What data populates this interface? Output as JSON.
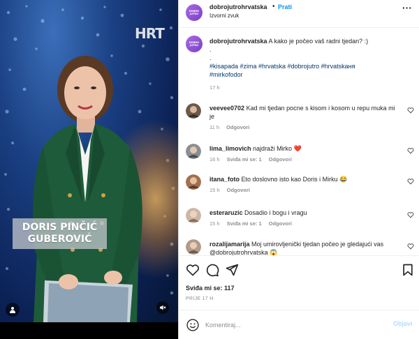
{
  "video": {
    "channel_logo": "HRT",
    "name_line1": "DORIS PINČIĆ",
    "name_line2": "GUBEROVIĆ",
    "tagged_users_icon": "person-icon",
    "mute_icon": "muted-speaker-icon"
  },
  "post": {
    "username": "dobrojutrohrvatska",
    "follow_label": "Prati",
    "audio_label": "Izvorni zvuk",
    "avatar_text_1": "DOBRO",
    "avatar_text_2": "JUTRO",
    "caption_user": "dobrojutrohrvatska",
    "caption_text": "A kako je počeo vaš radni tjedan? :)",
    "caption_dot1": ".",
    "caption_dot2": ".",
    "hashtags_line1": "#kisapada #zima #hrvatska #dobrojutro #hrvatskaня",
    "hashtags_line2": "#mirkofodor",
    "caption_time": "17 h"
  },
  "comments": [
    {
      "user": "veevee0702",
      "text": "Kad mi tjedan pocne s kisom i kosom u repu muka mi je",
      "time": "11 h",
      "likes": "",
      "reply": "Odgovori"
    },
    {
      "user": "lima_limovich",
      "text": "najdraži Mirko ❤️",
      "time": "16 h",
      "likes": "Sviđa mi se: 1",
      "reply": "Odgovori"
    },
    {
      "user": "itana_foto",
      "text": "Eto doslovno isto kao Doris i Mirku 😂",
      "time": "15 h",
      "likes": "",
      "reply": "Odgovori"
    },
    {
      "user": "esteraruzic",
      "text": "Dosadio i bogu i vragu",
      "time": "15 h",
      "likes": "Sviđa mi se: 1",
      "reply": "Odgovori"
    },
    {
      "user": "rozalijamarija",
      "text": "Moj umirovljenički tjedan počeo je gledajući vas @dobrojutrohrvatska 😱",
      "time": "",
      "likes": "",
      "reply": ""
    }
  ],
  "actions": {
    "like_icon": "heart-icon",
    "comment_icon": "comment-icon",
    "share_icon": "send-icon",
    "save_icon": "bookmark-icon",
    "likes_label": "Sviđa mi se: 117",
    "posted_label": "PRIJE 17 H"
  },
  "add_comment": {
    "placeholder": "Komentiraj...",
    "post_label": "Objavi",
    "emoji_icon": "emoji-icon"
  },
  "colors": {
    "link": "#0095f6",
    "hashtag": "#00376b",
    "muted": "#8e8e8e",
    "brand_avatar": "#8a4fd6",
    "jacket": "#1e5b3a"
  }
}
